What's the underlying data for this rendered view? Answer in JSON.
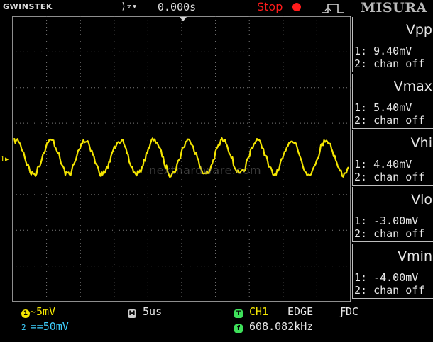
{
  "header": {
    "brand": "GWINSTEK",
    "trigger_position_icon": "trigger-position-icon",
    "horizontal_offset": "0.000s",
    "run_state": "Stop",
    "trigger_edge_icon": "rising-edge-icon",
    "watermark_logo": "MISURA"
  },
  "screen": {
    "ch1_marker": "1",
    "watermark_text": "nexthardware.com",
    "trace_color": "#f5e600",
    "grid_color": "#7a7a7a"
  },
  "measurements": [
    {
      "name": "Vpp",
      "ch1": "1: 9.40mV",
      "ch2": "2: chan off"
    },
    {
      "name": "Vmax",
      "ch1": "1: 5.40mV",
      "ch2": "2: chan off"
    },
    {
      "name": "Vhi",
      "ch1": "1: 4.40mV",
      "ch2": "2: chan off"
    },
    {
      "name": "Vlo",
      "ch1": "1: -3.00mV",
      "ch2": "2: chan off"
    },
    {
      "name": "Vmin",
      "ch1": "1: -4.00mV",
      "ch2": "2: chan off"
    }
  ],
  "status": {
    "ch1_number": "1",
    "ch1_coupling": "~",
    "ch1_scale": "5mV",
    "ch2_number": "2",
    "ch2_coupling": "==",
    "ch2_scale": "50mV",
    "timebase_badge": "M",
    "timebase": "5us",
    "trigger_source_badge": "T",
    "trigger_source": "CH1",
    "trigger_type": "EDGE",
    "trigger_coupling": "ƑDC",
    "frequency_badge": "f",
    "frequency": "608.082kHz"
  },
  "colors": {
    "ch1": "#f5e600",
    "ch2": "#3fd0ff",
    "stop": "#ff1b1b",
    "badge_green": "#3ee05a"
  }
}
